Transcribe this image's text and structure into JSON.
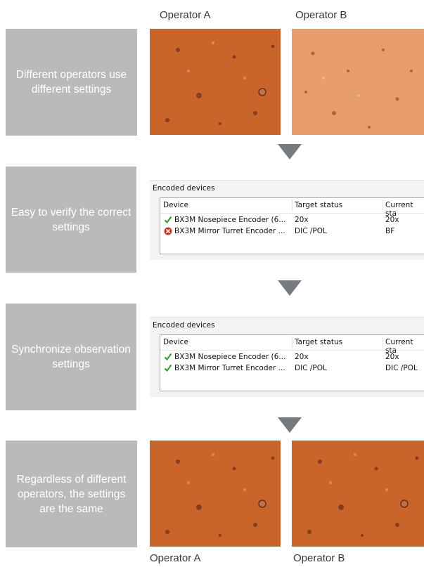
{
  "top_labels": {
    "operator_a": "Operator A",
    "operator_b": "Operator B"
  },
  "bottom_labels": {
    "operator_a": "Operator A",
    "operator_b": "Operator B"
  },
  "steps": [
    "Different operators use different settings",
    "Easy to verify the correct settings",
    "Synchronize observation settings",
    "Regardless of different operators, the settings are the same"
  ],
  "panel1": {
    "title": "Encoded devices",
    "columns": [
      "Device",
      "Target status",
      "Current sta"
    ],
    "rows": [
      {
        "status_icon": "green-check-icon",
        "device": "BX3M Nosepiece Encoder (6...",
        "target": "20x",
        "current": "20x"
      },
      {
        "status_icon": "red-x-icon",
        "device": "BX3M Mirror Turret Encoder ...",
        "target": "DIC /POL",
        "current": "BF"
      }
    ]
  },
  "panel2": {
    "title": "Encoded devices",
    "columns": [
      "Device",
      "Target status",
      "Current sta"
    ],
    "rows": [
      {
        "status_icon": "green-check-icon",
        "device": "BX3M Nosepiece Encoder (6...",
        "target": "20x",
        "current": "20x"
      },
      {
        "status_icon": "green-check-icon",
        "device": "BX3M Mirror Turret Encoder ...",
        "target": "DIC /POL",
        "current": "DIC /POL"
      }
    ]
  },
  "colors": {
    "step_box": "#b9babc",
    "arrow": "#777a7f",
    "sample_dark": "#c9652b",
    "sample_light": "#e79d6c",
    "ok": "#2e9a2e",
    "error": "#d2302a"
  }
}
